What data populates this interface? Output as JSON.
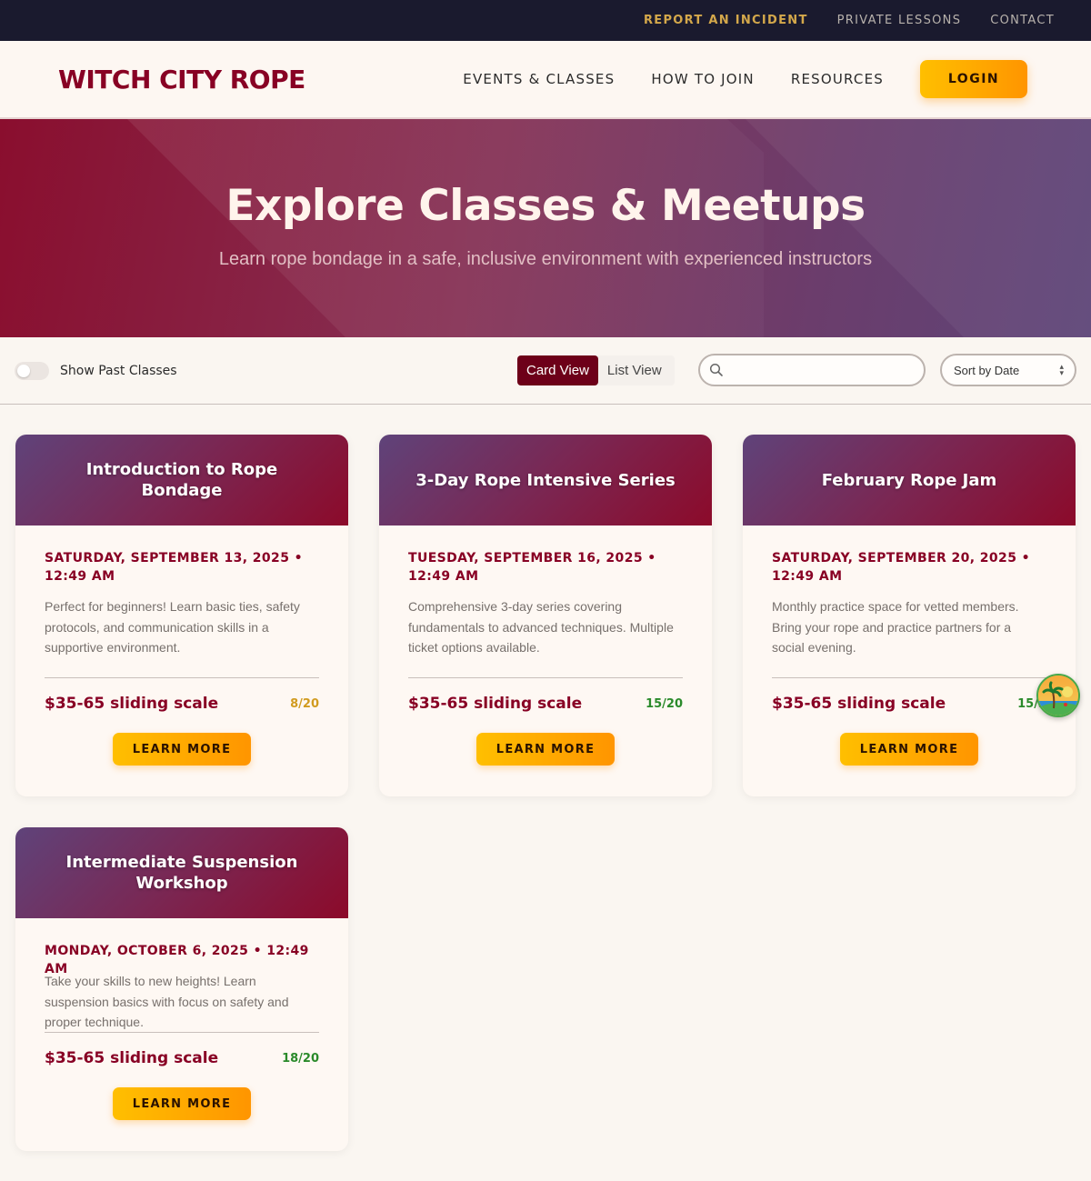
{
  "utility_nav": {
    "report_incident": "REPORT AN INCIDENT",
    "private_lessons": "PRIVATE LESSONS",
    "contact": "CONTACT"
  },
  "header": {
    "logo": "WITCH CITY ROPE",
    "nav": {
      "events": "EVENTS & CLASSES",
      "join": "HOW TO JOIN",
      "resources": "RESOURCES"
    },
    "login": "LOGIN"
  },
  "hero": {
    "title": "Explore Classes & Meetups",
    "subtitle": "Learn rope bondage in a safe, inclusive environment with experienced instructors"
  },
  "filters": {
    "show_past_label": "Show Past Classes",
    "show_past_enabled": false,
    "card_view": "Card View",
    "list_view": "List View",
    "active_view": "Card View",
    "search_value": "",
    "sort_value": "Sort by Date"
  },
  "events": [
    {
      "title": "Introduction to Rope Bondage",
      "date": "SATURDAY, SEPTEMBER 13, 2025 • 12:49 AM",
      "description": "Perfect for beginners! Learn basic ties, safety protocols, and communication skills in a supportive environment.",
      "price": "$35-65 sliding scale",
      "capacity": "8/20",
      "capacity_color": "#d19b1f",
      "cta": "LEARN MORE"
    },
    {
      "title": "3-Day Rope Intensive Series",
      "date": "TUESDAY, SEPTEMBER 16, 2025 • 12:49 AM",
      "description": "Comprehensive 3-day series covering fundamentals to advanced techniques. Multiple ticket options available.",
      "price": "$35-65 sliding scale",
      "capacity": "15/20",
      "capacity_color": "#2a8a2a",
      "cta": "LEARN MORE"
    },
    {
      "title": "February Rope Jam",
      "date": "SATURDAY, SEPTEMBER 20, 2025 • 12:49 AM",
      "description": "Monthly practice space for vetted members. Bring your rope and practice partners for a social evening.",
      "price": "$35-65 sliding scale",
      "capacity": "15/3",
      "capacity_color": "#2a8a2a",
      "cta": "LEARN MORE"
    },
    {
      "title": "Intermediate Suspension Workshop",
      "date": "MONDAY, OCTOBER 6, 2025 • 12:49 AM",
      "description": "Take your skills to new heights! Learn suspension basics with focus on safety and proper technique.",
      "price": "$35-65 sliding scale",
      "capacity": "18/20",
      "capacity_color": "#2a8a2a",
      "cta": "LEARN MORE"
    }
  ],
  "colors": {
    "brand": "#880124",
    "accent": "#ffbf00",
    "dark": "#1a1a2e"
  },
  "icons": {
    "search": "search-icon",
    "sort": "chevron-updown-icon",
    "widget": "palm-island-icon"
  }
}
